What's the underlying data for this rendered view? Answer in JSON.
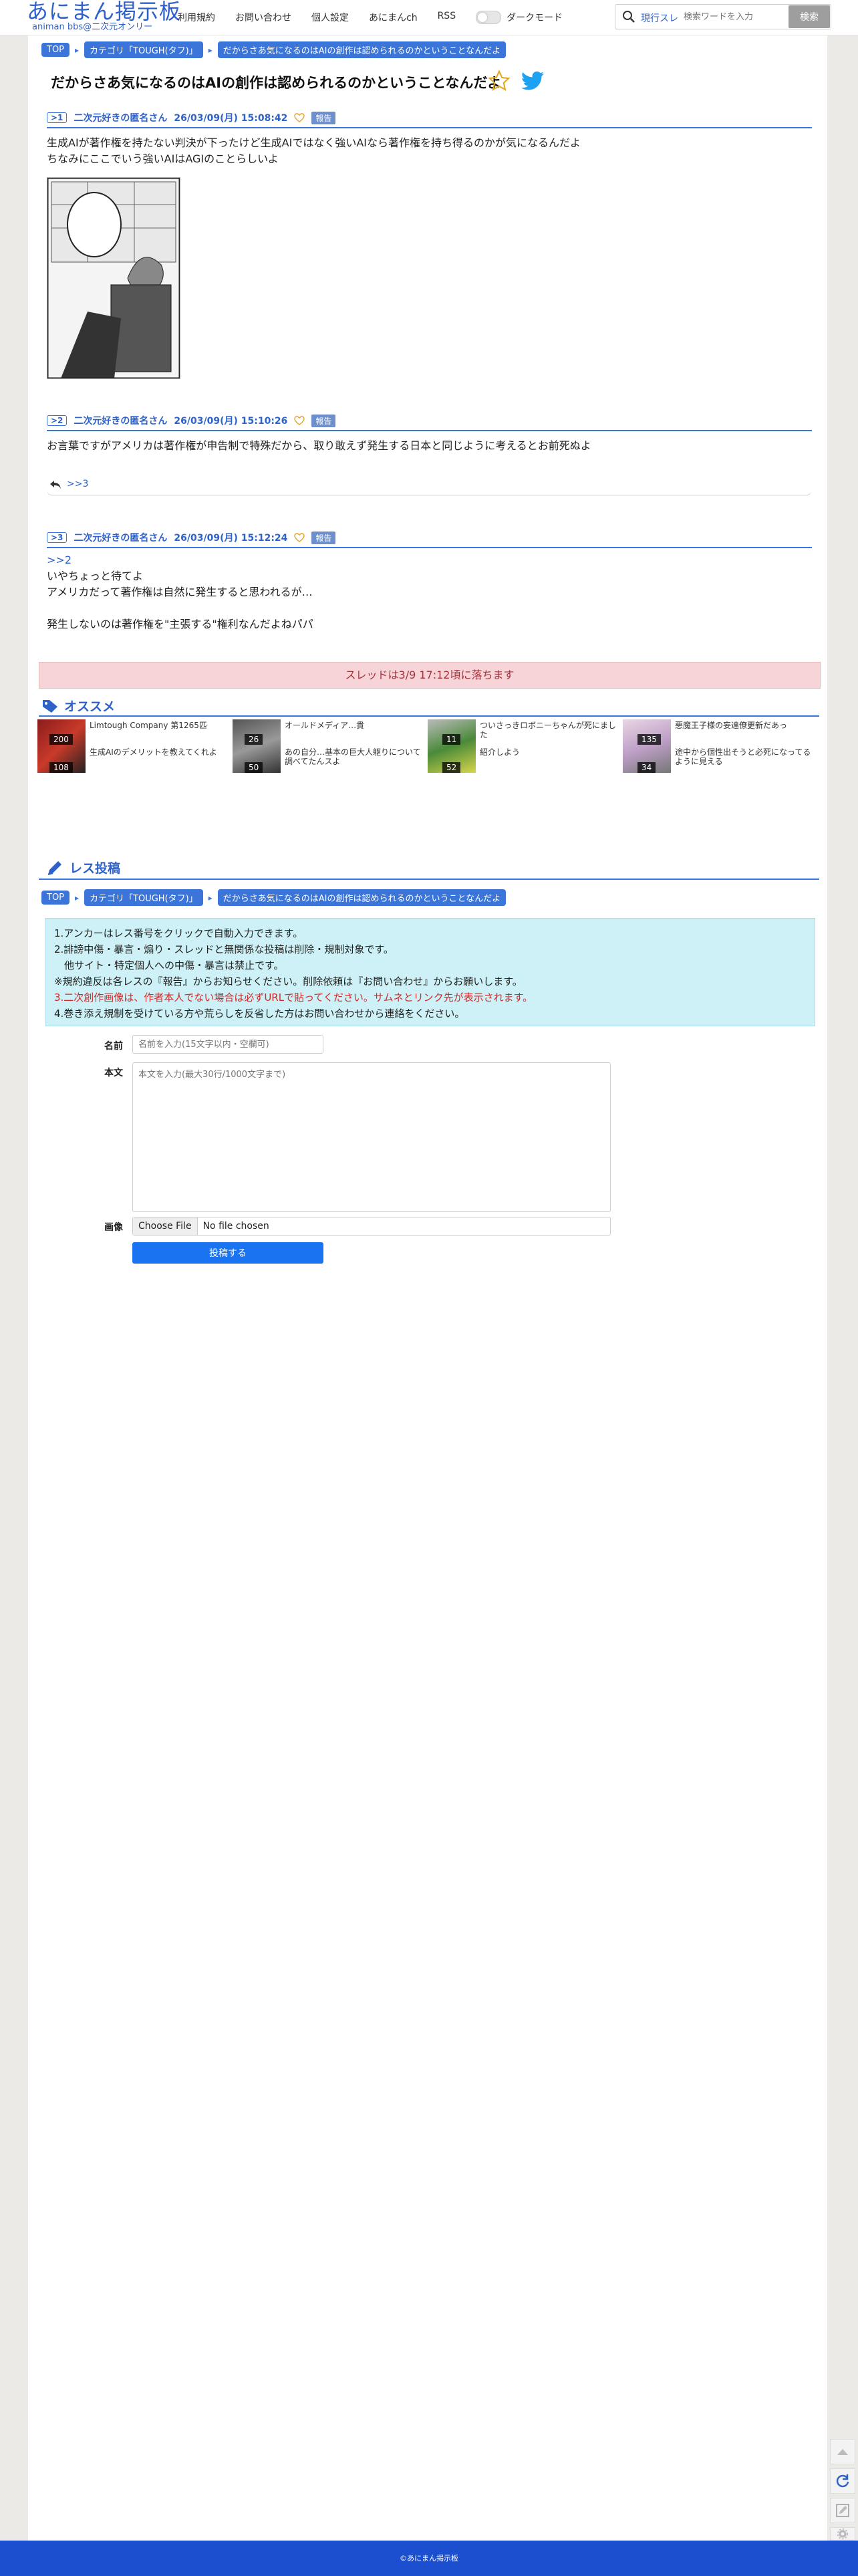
{
  "header": {
    "logo_title": "あにまん掲示板",
    "logo_sub": "animan bbs@二次元オンリー",
    "nav": [
      "利用規約",
      "お問い合わせ",
      "個人設定",
      "あにまんch",
      "RSS"
    ],
    "dark_mode_label": "ダークモード",
    "search_scope": "現行スレ",
    "search_placeholder": "検索ワードを入力",
    "search_button": "検索"
  },
  "breadcrumb": [
    "TOP",
    "カテゴリ「TOUGH(タフ)」",
    "だからさあ気になるのはAIの創作は認められるのかということなんだよ"
  ],
  "thread_title": "だからさあ気になるのはAIの創作は認められるのかということなんだよ",
  "posts": [
    {
      "num": ">1",
      "author": "二次元好きの匿名さん",
      "date": "26/03/09(月) 15:08:42",
      "report": "報告",
      "lines": [
        "生成AIが著作権を持たない判決が下ったけど生成AIではなく強いAIなら著作権を持ち得るのかが気になるんだよ",
        "ちなみにここでいう強いAIはAGIのことらしいよ"
      ]
    },
    {
      "num": ">2",
      "author": "二次元好きの匿名さん",
      "date": "26/03/09(月) 15:10:26",
      "report": "報告",
      "lines": [
        "お言葉ですがアメリカは著作権が申告制で特殊だから、取り敢えず発生する日本と同じように考えるとお前死ぬよ"
      ],
      "reply_ref": ">>3"
    },
    {
      "num": ">3",
      "author": "二次元好きの匿名さん",
      "date": "26/03/09(月) 15:12:24",
      "report": "報告",
      "anchor": ">>2",
      "lines": [
        "いやちょっと待てよ",
        "アメリカだって著作権は自然に発生すると思われるが…",
        "",
        "発生しないのは著作権を\"主張する\"権利なんだよねパパ"
      ]
    }
  ],
  "fall_notice": "スレッドは3/9 17:12頃に落ちます",
  "recommend": {
    "title": "オススメ",
    "items": [
      {
        "count": "200",
        "text": "Limtough Company 第1265匹"
      },
      {
        "count": "108",
        "text": "生成AIのデメリットを教えてくれよ"
      },
      {
        "count": "26",
        "text": "オールドメディア…貴"
      },
      {
        "count": "50",
        "text": "あの自分…基本の巨大人躯りについて調べてたんスよ"
      },
      {
        "count": "11",
        "text": "ついさっきロボニーちゃんが死にました"
      },
      {
        "count": "52",
        "text": "紹介しよう"
      },
      {
        "count": "135",
        "text": "悪魔王子様の妄達僚更新だあっ"
      },
      {
        "count": "34",
        "text": "途中から個性出そうと必死になってるように見える"
      }
    ]
  },
  "post_form": {
    "title": "レス投稿",
    "notices": [
      "1.アンカーはレス番号をクリックで自動入力できます。",
      "2.誹謗中傷・暴言・煽り・スレッドと無関係な投稿は削除・規制対象です。",
      "　他サイト・特定個人への中傷・暴言は禁止です。",
      "※規約違反は各レスの『報告』からお知らせください。削除依頼は『お問い合わせ』からお願いします。",
      "3.二次創作画像は、作者本人でない場合は必ずURLで貼ってください。サムネとリンク先が表示されます。",
      "4.巻き添え規制を受けている方や荒らしを反省した方はお問い合わせから連絡をください。"
    ],
    "name_label": "名前",
    "name_placeholder": "名前を入力(15文字以内・空欄可)",
    "body_label": "本文",
    "body_placeholder": "本文を入力(最大30行/1000文字まで)",
    "image_label": "画像",
    "file_button": "Choose File",
    "file_status": "No file chosen",
    "submit": "投稿する"
  },
  "footer": "©あにまん掲示板",
  "colors": {
    "accent": "#3b75d9",
    "footer": "#1b4fcf",
    "notice_bg": "#cdf1f6",
    "fall_bg": "#f7d4d7"
  }
}
